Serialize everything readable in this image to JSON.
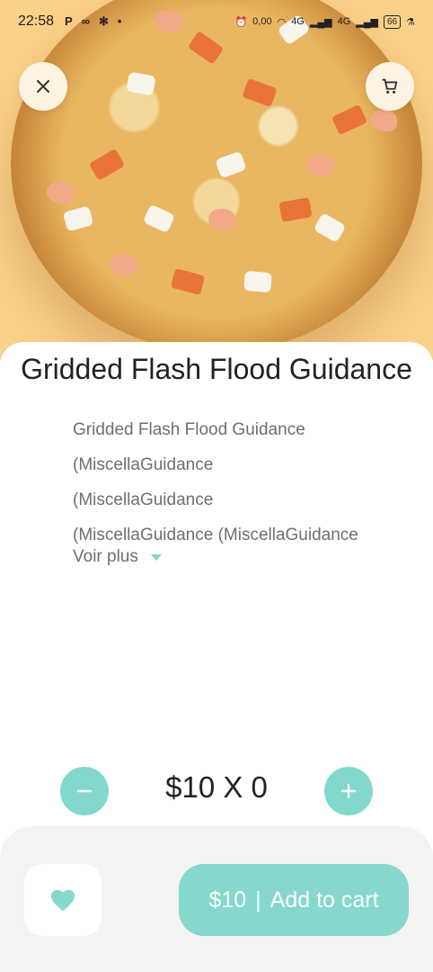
{
  "status_bar": {
    "time": "22:58",
    "left_icons": [
      "P",
      "∞"
    ],
    "speed": "0,00",
    "network1": "4G",
    "network2": "4G",
    "battery": "66"
  },
  "header": {
    "close_icon": "close-icon",
    "cart_icon": "cart-icon"
  },
  "product": {
    "title": "Gridded Flash Flood Guidance",
    "description_lines": [
      "Gridded Flash Flood Guidance",
      "(MiscellaGuidance",
      "(MiscellaGuidance",
      "(MiscellaGuidance (MiscellaGuidance"
    ],
    "see_more": "Voir plus"
  },
  "quantity": {
    "text": "$10 X 0"
  },
  "actions": {
    "price": "$10",
    "separator": "|",
    "add_label": "Add to cart",
    "favorite_icon": "heart-icon"
  },
  "colors": {
    "accent": "#86d8cf",
    "hero_background": "#fbd28a"
  }
}
